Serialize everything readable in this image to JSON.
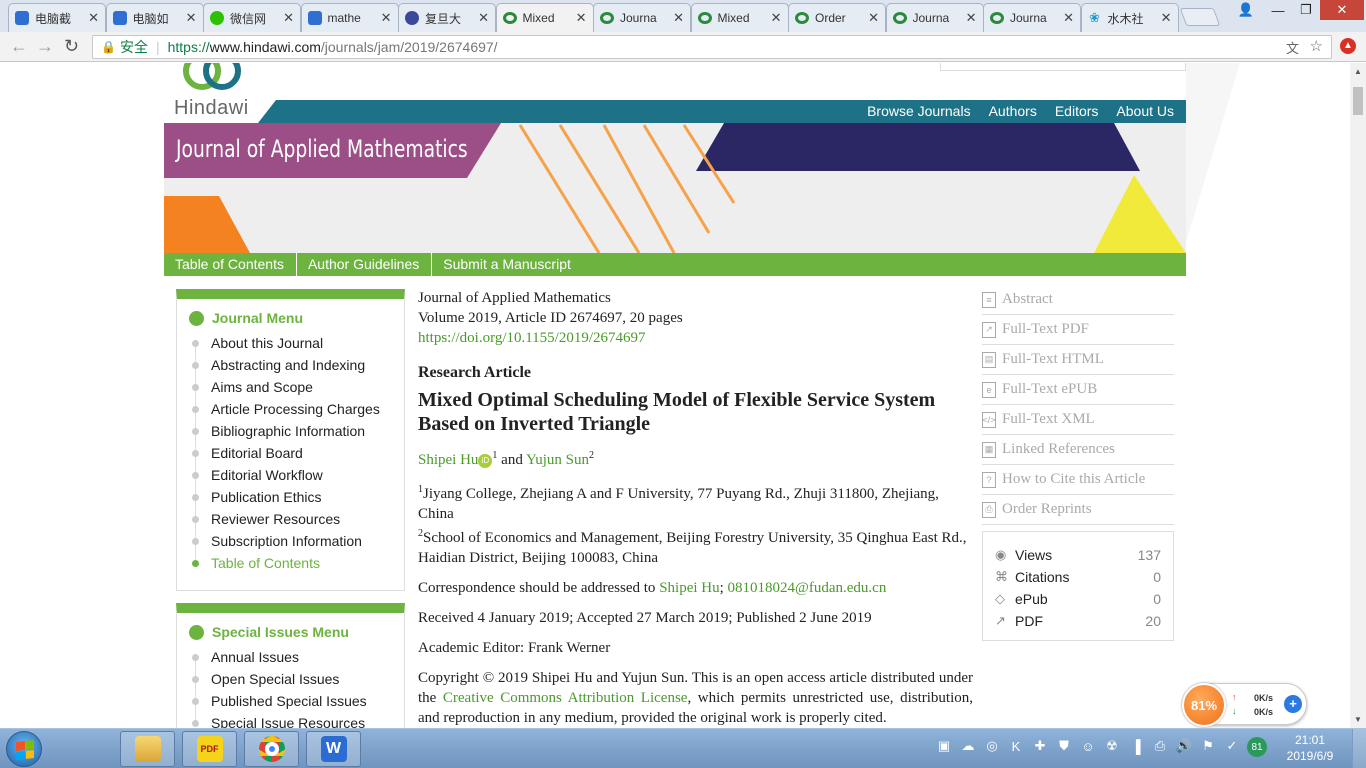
{
  "browser": {
    "tabs": [
      {
        "label": "电脑截",
        "icon": "paw-icon"
      },
      {
        "label": "电脑如",
        "icon": "paw-icon"
      },
      {
        "label": "微信网",
        "icon": "wechat-icon"
      },
      {
        "label": "mathe",
        "icon": "paw-icon"
      },
      {
        "label": "复旦大",
        "icon": "fudan-icon"
      },
      {
        "label": "Mixed",
        "icon": "hindawi-icon",
        "active": true
      },
      {
        "label": "Journa",
        "icon": "hindawi-icon"
      },
      {
        "label": "Mixed",
        "icon": "hindawi-icon"
      },
      {
        "label": "Order",
        "icon": "hindawi-icon"
      },
      {
        "label": "Journa",
        "icon": "hindawi-icon"
      },
      {
        "label": "Journa",
        "icon": "hindawi-icon"
      },
      {
        "label": "水木社",
        "icon": "shuimu-icon"
      }
    ],
    "secure_label": "安全",
    "url_proto": "https://",
    "url_host": "www.hindawi.com",
    "url_path": "/journals/jam/2019/2674697/"
  },
  "site": {
    "logo_text": "Hindawi",
    "top_nav": [
      "Browse Journals",
      "Authors",
      "Editors",
      "About Us"
    ],
    "journal_title": "Journal of Applied Mathematics",
    "green_nav": [
      "Table of Contents",
      "Author Guidelines",
      "Submit a Manuscript"
    ]
  },
  "journal_menu": {
    "title": "Journal Menu",
    "items": [
      "About this Journal",
      "Abstracting and Indexing",
      "Aims and Scope",
      "Article Processing Charges",
      "Bibliographic Information",
      "Editorial Board",
      "Editorial Workflow",
      "Publication Ethics",
      "Reviewer Resources",
      "Subscription Information",
      "Table of Contents"
    ]
  },
  "special_menu": {
    "title": "Special Issues Menu",
    "items": [
      "Annual Issues",
      "Open Special Issues",
      "Published Special Issues",
      "Special Issue Resources"
    ]
  },
  "article": {
    "journal": "Journal of Applied Mathematics",
    "volume": "Volume 2019, Article ID 2674697, 20 pages",
    "doi": "https://doi.org/10.1155/2019/2674697",
    "type": "Research Article",
    "title": "Mixed Optimal Scheduling Model of Flexible Service System Based on Inverted Triangle",
    "author1": "Shipei Hu",
    "author1_sup": "1",
    "and": "and",
    "author2": "Yujun Sun",
    "author2_sup": "2",
    "affil1_sup": "1",
    "affil1": "Jiyang College, Zhejiang A and F University, 77 Puyang Rd., Zhuji 311800, Zhejiang, China",
    "affil2_sup": "2",
    "affil2": "School of Economics and Management, Beijing Forestry University, 35 Qinghua East Rd., Haidian District, Beijing 100083, China",
    "corr_prefix": "Correspondence should be addressed to ",
    "corr_name": "Shipei Hu",
    "corr_sep": "; ",
    "corr_email": "081018024@fudan.edu.cn",
    "dates": "Received 4 January 2019; Accepted 27 March 2019; Published 2 June 2019",
    "editor": "Academic Editor: Frank Werner",
    "copyright_prefix": "Copyright © 2019 Shipei Hu and Yujun Sun. This is an open access article distributed under the ",
    "license": "Creative Commons Attribution License",
    "copyright_suffix": ", which permits unrestricted use, distribution, and reproduction in any medium, provided the original work is properly cited."
  },
  "sidebar_links": [
    {
      "label": "Abstract",
      "icon": "abstract-icon"
    },
    {
      "label": "Full-Text PDF",
      "icon": "pdf-icon"
    },
    {
      "label": "Full-Text HTML",
      "icon": "html-icon"
    },
    {
      "label": "Full-Text ePUB",
      "icon": "epub-icon"
    },
    {
      "label": "Full-Text XML",
      "icon": "xml-icon"
    },
    {
      "label": "Linked References",
      "icon": "references-icon"
    },
    {
      "label": "How to Cite this Article",
      "icon": "cite-icon"
    },
    {
      "label": "Order Reprints",
      "icon": "reprint-icon"
    }
  ],
  "metrics": [
    {
      "label": "Views",
      "value": "137",
      "icon": "eye-icon"
    },
    {
      "label": "Citations",
      "value": "0",
      "icon": "share-icon"
    },
    {
      "label": "ePub",
      "value": "0",
      "icon": "diamond-icon"
    },
    {
      "label": "PDF",
      "value": "20",
      "icon": "pdf-icon"
    }
  ],
  "speed_widget": {
    "percent": "81%",
    "up": "0K/s",
    "down": "0K/s"
  },
  "taskbar": {
    "time": "21:01",
    "date": "2019/6/9",
    "tray_badge": "81"
  },
  "colors": {
    "hindawi_green": "#6db33f",
    "teal_nav": "#1e7288",
    "purple_banner": "#9b4f86",
    "navy_banner": "#2a2764"
  }
}
